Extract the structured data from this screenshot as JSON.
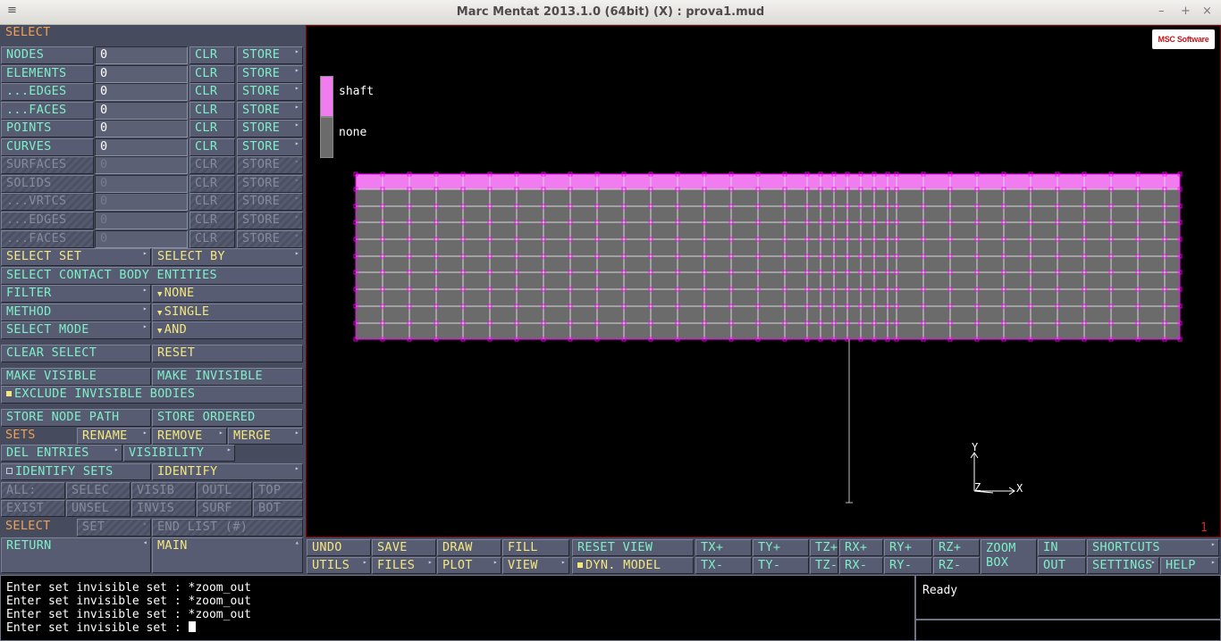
{
  "window": {
    "title": "Marc Mentat 2013.1.0 (64bit) (X) : prova1.mud",
    "menu_glyph": "≡",
    "min": "–",
    "max": "+",
    "close": "×"
  },
  "panel": {
    "header": "SELECT",
    "entity_rows": [
      {
        "label": "NODES",
        "value": "0",
        "enabled": true
      },
      {
        "label": "ELEMENTS",
        "value": "0",
        "enabled": true
      },
      {
        "label": "...EDGES",
        "value": "0",
        "enabled": true
      },
      {
        "label": "...FACES",
        "value": "0",
        "enabled": true
      },
      {
        "label": "POINTS",
        "value": "0",
        "enabled": true
      },
      {
        "label": "CURVES",
        "value": "0",
        "enabled": true
      },
      {
        "label": "SURFACES",
        "value": "0",
        "enabled": false
      },
      {
        "label": "SOLIDS",
        "value": "0",
        "enabled": false
      },
      {
        "label": "...VRTCS",
        "value": "0",
        "enabled": false
      },
      {
        "label": "...EDGES",
        "value": "0",
        "enabled": false
      },
      {
        "label": "...FACES",
        "value": "0",
        "enabled": false
      }
    ],
    "clr": "CLR",
    "store": "STORE",
    "select_set": "SELECT SET",
    "select_by": "SELECT BY",
    "contact_body": "SELECT CONTACT BODY ENTITIES",
    "filter": "FILTER",
    "filter_value": "NONE",
    "method": "METHOD",
    "method_value": "SINGLE",
    "select_mode": "SELECT MODE",
    "select_mode_value": "AND",
    "clear_select": "CLEAR SELECT",
    "reset": "RESET",
    "make_visible": "MAKE VISIBLE",
    "make_invisible": "MAKE INVISIBLE",
    "exclude_invisible": "EXCLUDE INVISIBLE BODIES",
    "store_node_path": "STORE NODE PATH",
    "store_ordered": "STORE ORDERED",
    "sets": "SETS",
    "rename": "RENAME",
    "remove": "REMOVE",
    "merge": "MERGE",
    "del_entries": "DEL ENTRIES",
    "visibility": "VISIBILITY",
    "identify_sets": "IDENTIFY SETS",
    "identify": "IDENTIFY",
    "all": "ALL:",
    "selec": "SELEC",
    "visib": "VISIB",
    "outl": "OUTL",
    "top": "TOP",
    "exist": "EXIST",
    "unsel": "UNSEL",
    "invis": "INVIS",
    "surf": "SURF",
    "bot": "BOT",
    "select": "SELECT",
    "set": "SET",
    "end_list": "END LIST (#)",
    "return": "RETURN",
    "main": "MAIN"
  },
  "viewport": {
    "legend": [
      {
        "label": "shaft",
        "color": "#f07cf0"
      },
      {
        "label": "none",
        "color": "#6b6b6b"
      }
    ],
    "axis_x": "X",
    "axis_y": "Y",
    "axis_z": "Z",
    "window_number": "1",
    "logo_text": "MSC Software",
    "accent_color": "#ff00ff"
  },
  "toolbar": {
    "undo": "UNDO",
    "save": "SAVE",
    "draw": "DRAW",
    "fill": "FILL",
    "reset_view": "RESET VIEW",
    "utils": "UTILS",
    "files": "FILES",
    "plot": "PLOT",
    "view": "VIEW",
    "dyn_model": "DYN. MODEL",
    "tx_plus": "TX+",
    "ty_plus": "TY+",
    "tz_plus": "TZ+",
    "rx_plus": "RX+",
    "ry_plus": "RY+",
    "rz_plus": "RZ+",
    "tx_minus": "TX-",
    "ty_minus": "TY-",
    "tz_minus": "TZ-",
    "rx_minus": "RX-",
    "ry_minus": "RY-",
    "rz_minus": "RZ-",
    "zoom": "ZOOM",
    "box": "BOX",
    "in": "IN",
    "out": "OUT",
    "shortcuts": "SHORTCUTS",
    "settings": "SETTINGS",
    "help": "HELP"
  },
  "command": {
    "history": [
      "Enter set invisible set : *zoom_out",
      "Enter set invisible set : *zoom_out",
      "Enter set invisible set : *zoom_out"
    ],
    "prompt": "Enter set invisible set : "
  },
  "status": {
    "text": "Ready"
  }
}
